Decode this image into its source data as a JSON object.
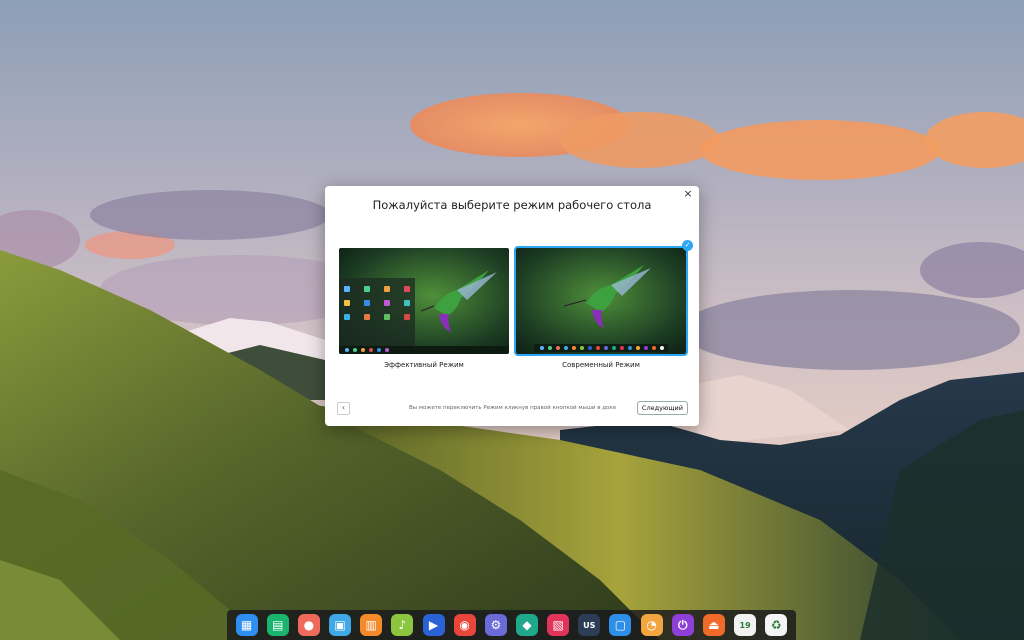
{
  "dialog": {
    "title": "Пожалуйста выберите режим рабочего стола",
    "close_glyph": "×",
    "modes": [
      {
        "label": "Эффективный Режим",
        "selected": false
      },
      {
        "label": "Современный Режим",
        "selected": true
      }
    ],
    "check_glyph": "✓",
    "back_glyph": "‹",
    "hint": "Вы можете переключить Режим кликнув правой кнопкой мыши в доке",
    "next_label": "Следующий",
    "accent_color": "#2ca7f8"
  },
  "dock": {
    "items": [
      {
        "name": "launcher-icon",
        "glyph": "▦",
        "color": "#2f8ff0"
      },
      {
        "name": "file-manager-icon",
        "glyph": "▤",
        "color": "#19b56e"
      },
      {
        "name": "screen-recorder-icon",
        "glyph": "●",
        "color": "#f06a5c"
      },
      {
        "name": "archive-manager-icon",
        "glyph": "▣",
        "color": "#3fa9e8"
      },
      {
        "name": "store-icon",
        "glyph": "▥",
        "color": "#f58a2a"
      },
      {
        "name": "music-icon",
        "glyph": "♪",
        "color": "#8cc63f"
      },
      {
        "name": "video-player-icon",
        "glyph": "▶",
        "color": "#2b63d6"
      },
      {
        "name": "chrome-icon",
        "glyph": "◉",
        "color": "#e8463a"
      },
      {
        "name": "settings-icon",
        "glyph": "⚙",
        "color": "#6a6ad8"
      },
      {
        "name": "app-store-icon",
        "glyph": "◆",
        "color": "#1fa88a"
      },
      {
        "name": "gallery-icon",
        "glyph": "▧",
        "color": "#e2335a"
      },
      {
        "name": "keyboard-layout-icon",
        "glyph": "US",
        "color": "#2d3d56"
      },
      {
        "name": "screenshot-icon",
        "glyph": "▢",
        "color": "#2d8fe8"
      },
      {
        "name": "clock-icon",
        "glyph": "◔",
        "color": "#f3a640"
      },
      {
        "name": "power-icon",
        "glyph": "⏻",
        "color": "#8d3fd8"
      },
      {
        "name": "eject-icon",
        "glyph": "⏏",
        "color": "#f06a2a"
      },
      {
        "name": "calendar-icon",
        "glyph": "19",
        "color": "#f2f2f2"
      },
      {
        "name": "trash-icon",
        "glyph": "♻",
        "color": "#f4f4f4"
      }
    ]
  }
}
